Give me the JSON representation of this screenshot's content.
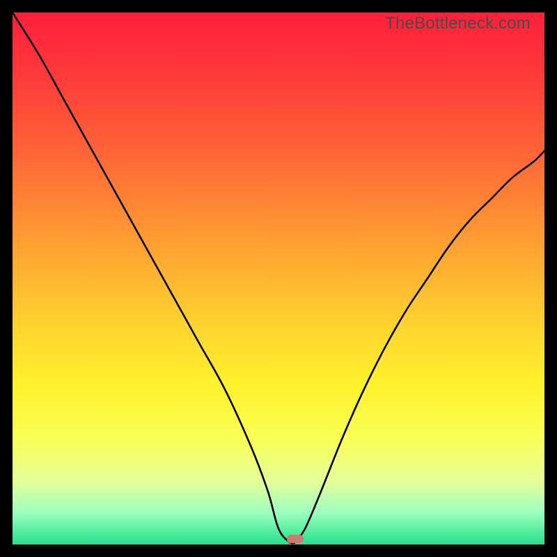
{
  "watermark": {
    "text": "TheBottleneck.com"
  },
  "gradient_colors": {
    "top": "#ff1f3a",
    "mid_upper": "#ff6a36",
    "mid": "#ffd12e",
    "mid_lower": "#fff22c",
    "bottom": "#23e28b"
  },
  "chart_data": {
    "type": "line",
    "title": "",
    "xlabel": "",
    "ylabel": "",
    "xlim": [
      0,
      100
    ],
    "ylim": [
      0,
      100
    ],
    "grid": false,
    "legend": false,
    "series": [
      {
        "name": "left-branch",
        "x": [
          0,
          5,
          10,
          15,
          20,
          25,
          30,
          35,
          40,
          45,
          48,
          50,
          52,
          53
        ],
        "values": [
          100,
          92,
          83,
          74,
          65,
          56,
          47,
          38,
          29,
          18,
          10,
          3,
          0.5,
          0.3
        ]
      },
      {
        "name": "right-branch",
        "x": [
          53,
          55,
          58,
          62,
          66,
          70,
          74,
          78,
          82,
          86,
          90,
          94,
          98,
          100
        ],
        "values": [
          0.3,
          3,
          10,
          20,
          29,
          37,
          44,
          50,
          56,
          61,
          65,
          69,
          72,
          74
        ]
      }
    ],
    "marker": {
      "x_frac": 0.532,
      "y_frac": 0.99
    }
  }
}
